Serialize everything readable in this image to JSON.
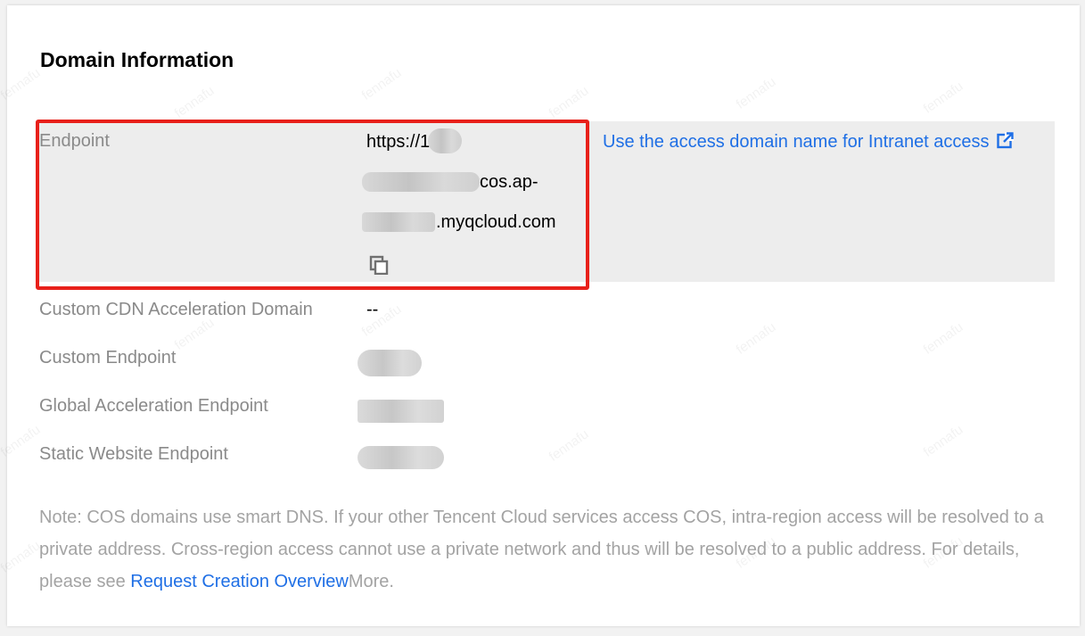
{
  "section": {
    "title": "Domain Information"
  },
  "endpoint": {
    "label": "Endpoint",
    "value_line1": "https://1",
    "value_line2_suffix": "cos.ap-",
    "value_line3_suffix": ".myqcloud.com",
    "copy_icon": "copy-icon",
    "intranet_link": "Use the access domain name for Intranet access",
    "intranet_link_icon": "external-link-icon"
  },
  "rows": [
    {
      "label": "Custom CDN Acceleration Domain",
      "value": "--"
    },
    {
      "label": "Custom Endpoint",
      "value": ""
    },
    {
      "label": "Global Acceleration Endpoint",
      "value": ""
    },
    {
      "label": "Static Website Endpoint",
      "value": ""
    }
  ],
  "note": {
    "text_before": "Note: COS domains use smart DNS. If your other Tencent Cloud services access COS, intra-region access will be resolved to a private address. Cross-region access cannot use a private network and thus will be resolved to a public address. For details, please see ",
    "link": "Request Creation Overview",
    "text_after": "More."
  },
  "watermark": "fennafu",
  "colors": {
    "highlight_border": "#e8201a",
    "link": "#1f6fe5",
    "row_highlight": "#ededed"
  }
}
